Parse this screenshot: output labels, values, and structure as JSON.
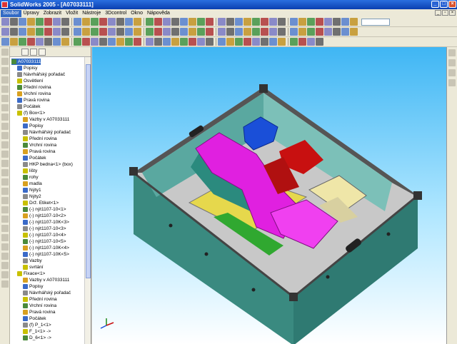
{
  "window": {
    "title": "SolidWorks 2005 - [A07033111]"
  },
  "menu": [
    "Soubor",
    "Úpravy",
    "Zobrazit",
    "Vložit",
    "Nástroje",
    "3Dcontrol",
    "Okno",
    "Nápověda"
  ],
  "tree": {
    "items": [
      {
        "label": "A07033111",
        "indent": 0,
        "selected": true
      },
      {
        "label": "Popisy",
        "indent": 1
      },
      {
        "label": "Návrhářský pořadač",
        "indent": 1
      },
      {
        "label": "Osvětlení",
        "indent": 1
      },
      {
        "label": "Přední rovina",
        "indent": 1
      },
      {
        "label": "Vrchní rovina",
        "indent": 1
      },
      {
        "label": "Pravá rovina",
        "indent": 1
      },
      {
        "label": "Počátek",
        "indent": 1
      },
      {
        "label": "(f) Box<1>",
        "indent": 1
      },
      {
        "label": "Vazby v A07033111",
        "indent": 2
      },
      {
        "label": "Popisy",
        "indent": 2
      },
      {
        "label": "Návrhářský pořadač",
        "indent": 2
      },
      {
        "label": "Přední rovina",
        "indent": 2
      },
      {
        "label": "Vrchní rovina",
        "indent": 2
      },
      {
        "label": "Pravá rovina",
        "indent": 2
      },
      {
        "label": "Počátek",
        "indent": 2
      },
      {
        "label": "HKP bedna<1> (box)",
        "indent": 2
      },
      {
        "label": "lišty",
        "indent": 2
      },
      {
        "label": "rohy",
        "indent": 2
      },
      {
        "label": "madla",
        "indent": 2
      },
      {
        "label": "Nýty1",
        "indent": 2
      },
      {
        "label": "Nýty2",
        "indent": 2
      },
      {
        "label": "Drž. Etiket<1>",
        "indent": 2
      },
      {
        "label": "(-) nýt1107-10<1>",
        "indent": 2
      },
      {
        "label": "(-) nýt1107-10<2>",
        "indent": 2
      },
      {
        "label": "(-) nýt1107-10K<3>",
        "indent": 2
      },
      {
        "label": "(-) nýt1107-10<3>",
        "indent": 2
      },
      {
        "label": "(-) nýt1107-10<4>",
        "indent": 2
      },
      {
        "label": "(-) nýt1107-10<5>",
        "indent": 2
      },
      {
        "label": "(-) nýt1107-10K<4>",
        "indent": 2
      },
      {
        "label": "(-) nýt1107-10K<5>",
        "indent": 2
      },
      {
        "label": "Vazby",
        "indent": 2
      },
      {
        "label": "svrtání",
        "indent": 2
      },
      {
        "label": "Fixace<1>",
        "indent": 1
      },
      {
        "label": "Vazby v A07033111",
        "indent": 2
      },
      {
        "label": "Popisy",
        "indent": 2
      },
      {
        "label": "Návrhářský pořadač",
        "indent": 2
      },
      {
        "label": "Přední rovina",
        "indent": 2
      },
      {
        "label": "Vrchní rovina",
        "indent": 2
      },
      {
        "label": "Pravá rovina",
        "indent": 2
      },
      {
        "label": "Počátek",
        "indent": 2
      },
      {
        "label": "(f) P_1<1>",
        "indent": 2
      },
      {
        "label": "F_1<1> ->",
        "indent": 2
      },
      {
        "label": "D_6<1> ->",
        "indent": 2
      }
    ]
  },
  "colors": {
    "title_bar": "#0a3fb0",
    "viewport_top": "#3fb6f4",
    "box_wall": "#3a8a80",
    "box_floor": "#c8c8c8",
    "part_magenta": "#e020e0",
    "part_blue": "#1a4fd8",
    "part_red": "#c81010",
    "part_green": "#30a830",
    "part_yellow": "#e6d84c"
  }
}
